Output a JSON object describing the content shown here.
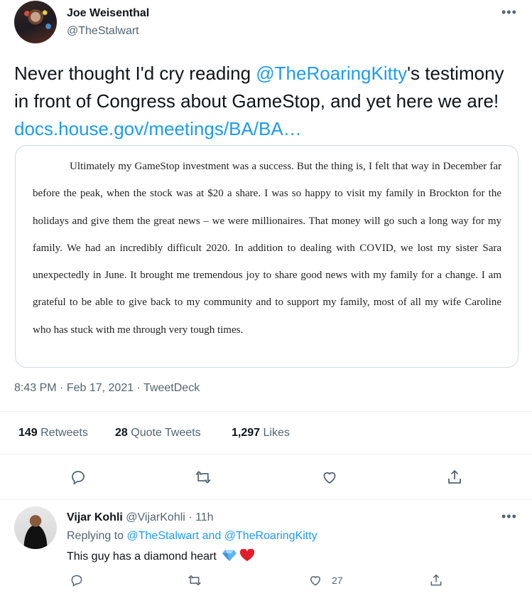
{
  "tweet": {
    "author_name": "Joe Weisenthal",
    "author_handle": "@TheStalwart",
    "more": "•••",
    "text_before": "Never thought I'd cry reading ",
    "mention": "@TheRoaringKitty",
    "text_after": "'s testimony in front of Congress about GameStop, and yet here we are! ",
    "link": "docs.house.gov/meetings/BA/BA…",
    "document_text": "Ultimately my GameStop investment was a success.  But the thing is, I felt that way in December far before the peak, when the stock was at $20 a share.  I was so happy to visit my family in Brockton for the holidays and give them the great news – we were millionaires.  That money will go such a long way for my family.  We had an incredibly difficult 2020.  In addition to dealing with COVID, we lost my sister Sara unexpectedly in June.  It brought me tremendous joy to share good news with my family for a change.  I am grateful to be able to give back to my community and to support my family, most of all my wife Caroline who has stuck with me through very tough times.",
    "time": "8:43 PM",
    "date": "Feb 17, 2021",
    "source": "TweetDeck",
    "retweets_count": "149",
    "retweets_label": "Retweets",
    "quotes_count": "28",
    "quotes_label": "Quote Tweets",
    "likes_count": "1,297",
    "likes_label": "Likes"
  },
  "reply": {
    "author_name": "Vijar Kohli",
    "author_handle": "@VijarKohli",
    "age": "11h",
    "more": "•••",
    "replying_to_label": "Replying to",
    "replying_to_1": "@TheStalwart",
    "replying_and": "and",
    "replying_to_2": "@TheRoaringKitty",
    "text": "This guy has a diamond heart",
    "likes_count": "27"
  },
  "icons": [
    "reply-icon",
    "retweet-icon",
    "like-icon",
    "share-icon",
    "more-icon",
    "diamond-emoji",
    "heart-emoji"
  ],
  "colors": {
    "link": "#1d9bf0",
    "secondary": "#536471",
    "primary": "#0f1419",
    "border": "#cfd9de",
    "divider": "#eff3f4"
  }
}
